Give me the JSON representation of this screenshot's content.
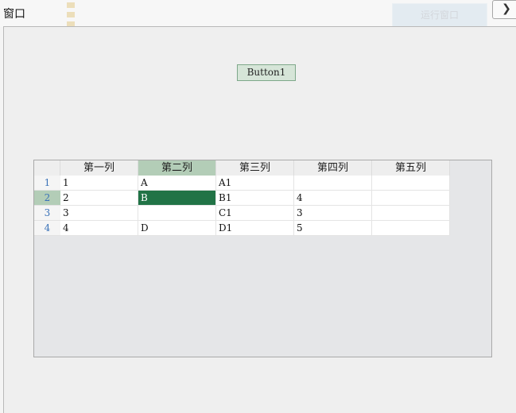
{
  "window": {
    "title": "窗口"
  },
  "background": {
    "corner_button_label": "",
    "faded_button_label": "运行窗口"
  },
  "button1": {
    "label": "Button1"
  },
  "grid": {
    "columns": [
      "第一列",
      "第二列",
      "第三列",
      "第四列",
      "第五列"
    ],
    "selected_column": 1,
    "selected_row": 1,
    "rows": [
      {
        "num": "1",
        "cells": [
          "1",
          "A",
          "A1",
          "",
          ""
        ]
      },
      {
        "num": "2",
        "cells": [
          "2",
          "B",
          "B1",
          "4",
          ""
        ]
      },
      {
        "num": "3",
        "cells": [
          "3",
          "",
          "C1",
          "3",
          ""
        ]
      },
      {
        "num": "4",
        "cells": [
          "4",
          "D",
          "D1",
          "5",
          ""
        ]
      }
    ]
  }
}
